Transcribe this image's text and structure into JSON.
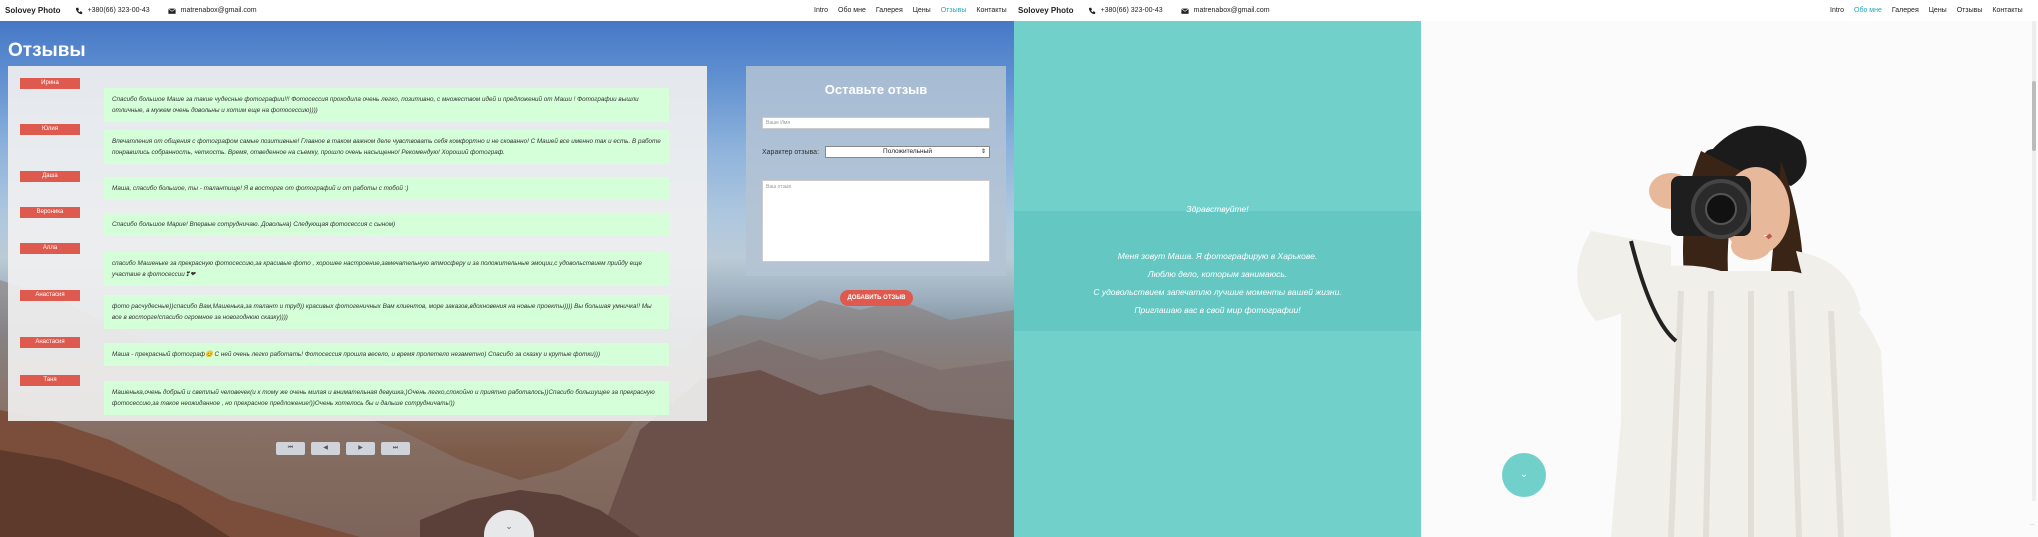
{
  "navbar": {
    "brand": "Solovey Photo",
    "phone": "+380(66) 323-00-43",
    "email": "matrenabox@gmail.com",
    "menu": [
      "Intro",
      "Обо мне",
      "Галерея",
      "Цены",
      "Отзывы",
      "Контакты"
    ]
  },
  "left_nav": {
    "active_index": 4
  },
  "right_nav": {
    "active_index": 1
  },
  "reviews": {
    "title": "Отзывы",
    "items": [
      {
        "name": "Ирина",
        "text": "Спасибо большое Маше за такие чудесные фотографии!!! Фотосессия проходила очень легко, позитивно, с множеством идей и предложений от Маши ! Фотографии вышли отличные, а мужем очень довольны и хотим еще на фотосессию))))"
      },
      {
        "name": "Юлия",
        "text": "Впечатления от общения с фотографом самые позитивные! Главное в таком важном деле чувствовать себя комфортно и не скованно! С Машей все именно так и есть. В работе понравились собранность, четкость. Время, отведенное на съемку, прошло очень насыщенно! Рекомендую! Хороший фотограф."
      },
      {
        "name": "Даша",
        "text": "Маша, спасибо большое, ты - талантище! Я в восторге от фотографий и от работы с тобой :)"
      },
      {
        "name": "Вероника",
        "text": "Спасибо большое Марие! Впервые сотрудничаю. Довольна) Следующая фотосессия с сыном)"
      },
      {
        "name": "Алла",
        "text": "спасибо Машеньке за прекрасную фотосессию,за красивые фото , хорошее настроение,замечательную атмосферу и за положительные эмоции,с удовольствием прийду еще участвие в фотосессии❣❤"
      },
      {
        "name": "Анастасия",
        "text": "фото расчудесные))спасибо Вам,Машенька,за талант и труд)) красивых фотогеничных Вам клиентов, море заказов,вдохновения на новые проекты)))) Вы большая умничка!! Мы все в восторге!спасибо огромное за новогоднюю сказку))))"
      },
      {
        "name": "Анастасия",
        "text": "Маша - прекрасный фотограф😊 С ней очень легко работать! Фотосессия прошла весело, и время пролетело незаметно) Спасибо за сказку и крутые фотки)))"
      },
      {
        "name": "Таня",
        "text": "Машенька,очень добрый и светлый человечек(и к тому же очень милая и внимательная девушка,)Очень легко,спокойно и приятно работалось))Спасибо большущее за прекрасную фотосессию,за такое неожиданное , но прекрасное предложение!))Очень хотелось бы и дальше сотрудничать!))"
      }
    ],
    "pager": [
      "⏮",
      "◀",
      "▶",
      "⏭"
    ]
  },
  "form": {
    "title": "Оставьте отзыв",
    "name_placeholder": "Ваше Имя",
    "character_label": "Характер отзыва:",
    "character_value": "Положительный",
    "text_placeholder": "Ваш отзыв",
    "submit_label": "ДОБАВИТЬ ОТЗЫВ"
  },
  "about": {
    "greeting": "Здравствуйте!",
    "lines": [
      "Меня зовут Маша. Я фотографирую в Харькове.",
      "Люблю дело, которым занимаюсь.",
      "С удовольствием запечатлю лучшие моменты вашей жизни.",
      "Приглашаю вас в свой мир фотографии!"
    ]
  },
  "misc": {
    "corner": "..."
  },
  "colors": {
    "accent": "#2aa7b5",
    "teal": "#72d0cb",
    "red_btn": "#de5a4e",
    "review_bg": "#d4ffd8"
  }
}
